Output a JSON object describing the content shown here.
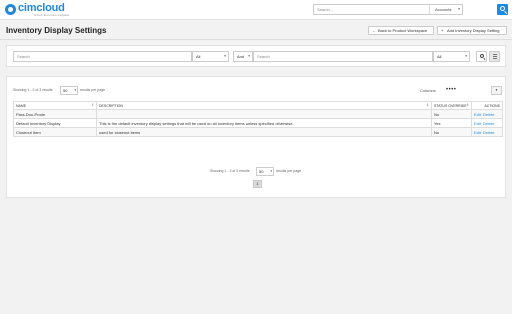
{
  "header": {
    "brand": "cimcloud",
    "brand_tagline": "formerly Ecommerce Integrated",
    "search_placeholder": "Search...",
    "search_scope": "Accounts"
  },
  "page": {
    "title": "Inventory Display Settings",
    "back_button_label": "Back to Product Workspace",
    "add_button_label": "Add Inventory Display Setting"
  },
  "filters": {
    "search1_placeholder": "Search",
    "select1_value": "All",
    "logic_value": "And",
    "search2_placeholder": "Search",
    "select2_value": "All"
  },
  "results": {
    "showing_text": "Showing 1 - 3 of 3 results",
    "per_page_value": "50",
    "per_page_suffix": "results per page",
    "columns_label": "Columns",
    "columns": [
      "Name",
      "Description",
      "Status Override",
      "Actions"
    ],
    "rows": [
      {
        "name": "Para-Doo-Prode",
        "description": "",
        "status_override": "No"
      },
      {
        "name": "Default Inventory Display",
        "description": "This is the default inventory display settings that will be used on all inventory items unless specified otherwise.",
        "status_override": "Yes"
      },
      {
        "name": "Closeout Item",
        "description": "used for closeout items",
        "status_override": "No"
      }
    ],
    "edit_label": "Edit",
    "delete_label": "Delete",
    "current_page": "1"
  },
  "icons": {
    "search": "search-icon",
    "back": "arrow-left-icon",
    "add": "plus-icon",
    "list": "list-icon",
    "sort": "sort-icon",
    "caret": "chevron-down-icon"
  },
  "colors": {
    "brand": "#1e88e5",
    "link": "#1e88e5",
    "background": "#f2f2f2"
  }
}
